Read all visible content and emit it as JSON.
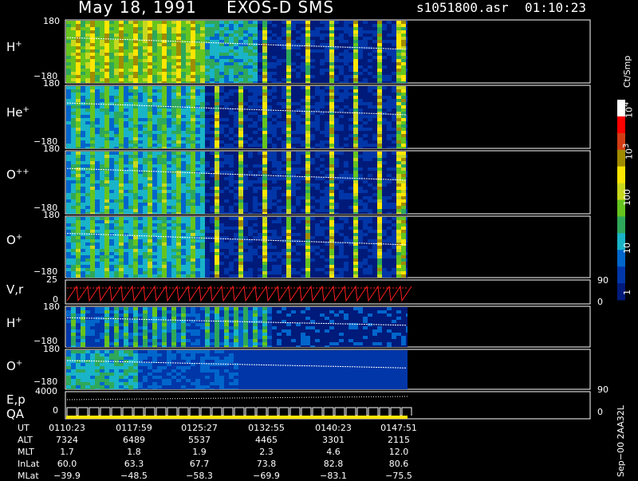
{
  "header": {
    "date": "May 18, 1991",
    "instrument": "EXOS-D SMS",
    "file": "s1051800.asr",
    "time": "01:10:23"
  },
  "colorbar": {
    "unit_label": "Ct/Smp",
    "ticks": [
      "1",
      "10",
      "100",
      "10",
      "10"
    ],
    "tick_sups": [
      "",
      "",
      "",
      "3",
      "4"
    ]
  },
  "panels": [
    {
      "label": "H",
      "sup": "+",
      "ymax": "180",
      "ymin": "−180",
      "species": "H+"
    },
    {
      "label": "He",
      "sup": "+",
      "ymax": "180",
      "ymin": "−180",
      "species": "He+"
    },
    {
      "label": "O",
      "sup": "++",
      "ymax": "180",
      "ymin": "−180",
      "species": "O++"
    },
    {
      "label": "O",
      "sup": "+",
      "ymax": "180",
      "ymin": "−180",
      "species": "O+"
    },
    {
      "label": "V,r",
      "sup": "",
      "ymax": "25",
      "ymin": "0",
      "right_top": "90",
      "right_bottom": "0"
    },
    {
      "label": "H",
      "sup": "+",
      "ymax": "180",
      "ymin": "−180"
    },
    {
      "label": "O",
      "sup": "+",
      "ymax": "180",
      "ymin": "−180"
    },
    {
      "label": "E,p",
      "label2": "QA",
      "ymax": "4000",
      "ymin": "0",
      "right_top": "90",
      "right_bottom": "0"
    }
  ],
  "ephemeris": {
    "row_labels": [
      "UT",
      "ALT",
      "MLT",
      "InLat",
      "MLat"
    ],
    "columns": [
      {
        "UT": "0110:23",
        "ALT": "7324",
        "MLT": "1.7",
        "InLat": "60.0",
        "MLat": "−39.9"
      },
      {
        "UT": "0117:59",
        "ALT": "6489",
        "MLT": "1.8",
        "InLat": "63.3",
        "MLat": "−48.5"
      },
      {
        "UT": "0125:27",
        "ALT": "5537",
        "MLT": "1.9",
        "InLat": "67.7",
        "MLat": "−58.3"
      },
      {
        "UT": "0132:55",
        "ALT": "4465",
        "MLT": "2.3",
        "InLat": "73.8",
        "MLat": "−69.9"
      },
      {
        "UT": "0140:23",
        "ALT": "3301",
        "MLT": "4.6",
        "InLat": "82.8",
        "MLat": "−83.1"
      },
      {
        "UT": "0147:51",
        "ALT": "2115",
        "MLT": "12.0",
        "InLat": "80.6",
        "MLat": "−75.5"
      }
    ]
  },
  "side_text": "Sep−00  2AA32L",
  "chart_data": {
    "type": "heatmap",
    "title": "May 18, 1991   EXOS-D SMS",
    "colorbar_label": "Ct/Smp",
    "colorbar_range": [
      1,
      10000
    ],
    "colorbar_scale": "log",
    "colors": [
      "#001a7a",
      "#0036a8",
      "#0066cc",
      "#19b4c8",
      "#2ea85a",
      "#66c41e",
      "#c8d81e",
      "#ffe600",
      "#a08c00",
      "#d23c14",
      "#ff0000",
      "#ffffff"
    ],
    "panels": [
      {
        "species": "H+",
        "ylim": [
          -180,
          180
        ]
      },
      {
        "species": "He+",
        "ylim": [
          -180,
          180
        ]
      },
      {
        "species": "O++",
        "ylim": [
          -180,
          180
        ]
      },
      {
        "species": "O+",
        "ylim": [
          -180,
          180
        ]
      },
      {
        "name": "V,r",
        "ylim": [
          0,
          25
        ],
        "right_ylim": [
          0,
          90
        ]
      },
      {
        "species": "H+",
        "ylim": [
          -180,
          180
        ]
      },
      {
        "species": "O+",
        "ylim": [
          -180,
          180
        ]
      },
      {
        "name": "E,p / QA",
        "ylim": [
          0,
          4000
        ],
        "right_ylim": [
          0,
          90
        ]
      }
    ],
    "x_ticks": [
      "0110:23",
      "0117:59",
      "0125:27",
      "0132:55",
      "0140:23",
      "0147:51"
    ]
  }
}
